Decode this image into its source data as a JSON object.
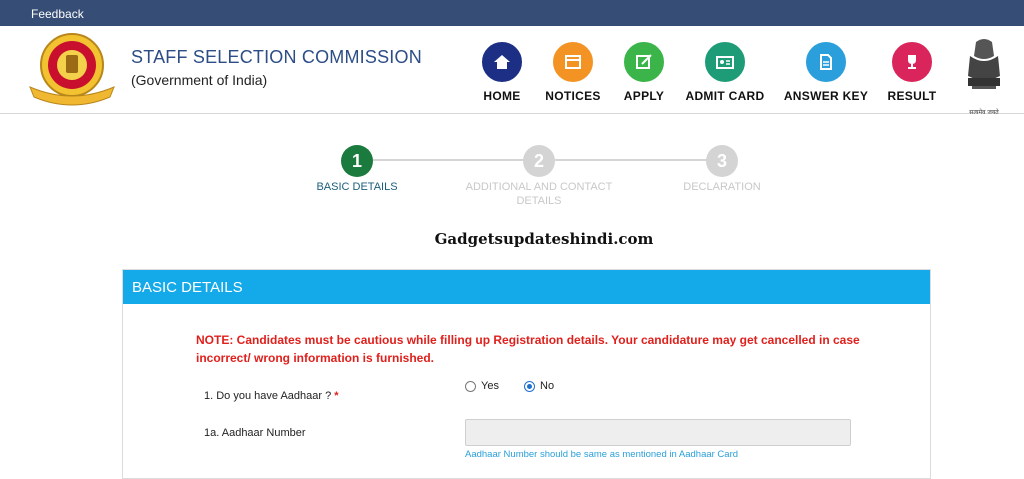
{
  "topbar": {
    "feedback_label": "Feedback"
  },
  "header": {
    "title": "STAFF SELECTION COMMISSION",
    "subtitle": "(Government of India)",
    "emblem_caption": "सत्यमेव जयते"
  },
  "nav": [
    {
      "label": "HOME",
      "icon": "home-icon",
      "color": "#1c2f84"
    },
    {
      "label": "NOTICES",
      "icon": "notices-icon",
      "color": "#f29324"
    },
    {
      "label": "APPLY",
      "icon": "apply-icon",
      "color": "#3bb54a"
    },
    {
      "label": "ADMIT CARD",
      "icon": "admit-card-icon",
      "color": "#1e9c78"
    },
    {
      "label": "ANSWER KEY",
      "icon": "answer-key-icon",
      "color": "#2a9fdc"
    },
    {
      "label": "RESULT",
      "icon": "result-icon",
      "color": "#d9255c"
    }
  ],
  "stepper": [
    {
      "number": "1",
      "label": "BASIC DETAILS",
      "state": "active",
      "color": "#1b7a3d"
    },
    {
      "number": "2",
      "label": "ADDITIONAL AND CONTACT DETAILS",
      "state": "inactive",
      "color": "#cfcfcf"
    },
    {
      "number": "3",
      "label": "DECLARATION",
      "state": "inactive",
      "color": "#cfcfcf"
    }
  ],
  "watermark": "Gadgetsupdateshindi.com",
  "panel": {
    "heading": "BASIC DETAILS",
    "note": "NOTE: Candidates must be cautious while filling up Registration details. Your candidature may get cancelled in case incorrect/ wrong information is furnished.",
    "q1": {
      "label": "1. Do you have Aadhaar ?",
      "required_mark": "*",
      "options": [
        "Yes",
        "No"
      ],
      "selected": "No"
    },
    "q1a": {
      "label": "1a. Aadhaar Number",
      "value": "",
      "hint": "Aadhaar Number should be same as mentioned in Aadhaar Card"
    }
  },
  "colors": {
    "topbar": "#364d76",
    "panel_header": "#14a9e8",
    "note_text": "#e0201c",
    "title_text": "#2c4d86"
  }
}
